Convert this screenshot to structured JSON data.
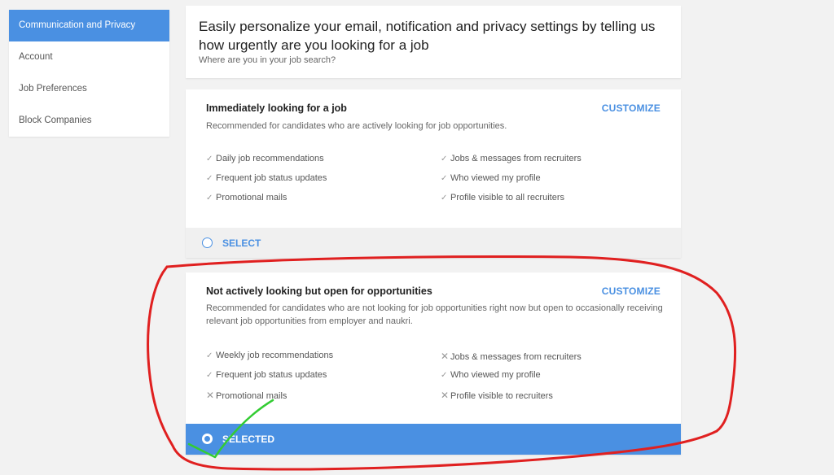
{
  "sidebar": {
    "items": [
      {
        "label": "Communication and Privacy"
      },
      {
        "label": "Account"
      },
      {
        "label": "Job Preferences"
      },
      {
        "label": "Block Companies"
      }
    ]
  },
  "header": {
    "title": "Easily personalize your email, notification and privacy settings by telling us how urgently are you looking for a job",
    "subtitle": "Where are you in your job search?"
  },
  "options": [
    {
      "title": "Immediately looking for a job",
      "customize": "CUSTOMIZE",
      "description": "Recommended for candidates who are actively looking for job opportunities.",
      "features_left": [
        {
          "text": "Daily job recommendations",
          "enabled": true
        },
        {
          "text": "Frequent job status updates",
          "enabled": true
        },
        {
          "text": "Promotional mails",
          "enabled": true
        }
      ],
      "features_right": [
        {
          "text": "Jobs & messages from recruiters",
          "enabled": true
        },
        {
          "text": "Who viewed my profile",
          "enabled": true
        },
        {
          "text": "Profile visible to all recruiters",
          "enabled": true
        }
      ],
      "action": "SELECT"
    },
    {
      "title": "Not actively looking but open for opportunities",
      "customize": "CUSTOMIZE",
      "description": "Recommended for candidates who are not looking for job opportunities right now but open to occasionally receiving relevant job opportunities from employer and naukri.",
      "features_left": [
        {
          "text": "Weekly job recommendations",
          "enabled": true
        },
        {
          "text": "Frequent job status updates",
          "enabled": true
        },
        {
          "text": "Promotional mails",
          "enabled": false
        }
      ],
      "features_right": [
        {
          "text": "Jobs & messages from recruiters",
          "enabled": false
        },
        {
          "text": "Who viewed my profile",
          "enabled": true
        },
        {
          "text": "Profile visible to recruiters",
          "enabled": false
        }
      ],
      "action": "SELECTED"
    }
  ],
  "marks": {
    "check": "✓",
    "cross": "✕"
  },
  "colors": {
    "accent": "#4a90e2",
    "annotation_red": "#e02020",
    "annotation_green": "#33cc33"
  }
}
